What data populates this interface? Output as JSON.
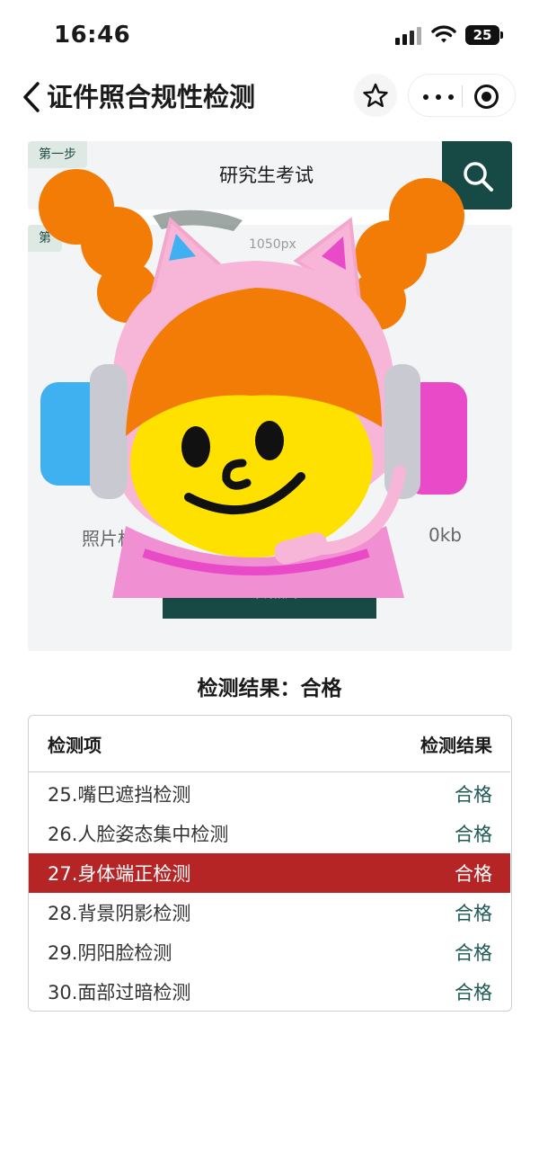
{
  "status_bar": {
    "time": "16:46",
    "battery": "25"
  },
  "nav": {
    "title": "证件照合规性检测"
  },
  "step1": {
    "badge": "第一步",
    "exam": "研究生考试"
  },
  "step2": {
    "badge": "第",
    "size_text": "1050px",
    "format_text": "照片格",
    "kb_text": "0kb",
    "upload_label": "上传照片"
  },
  "result": {
    "heading": "检测结果：合格",
    "col_item": "检测项",
    "col_result": "检测结果",
    "rows": [
      {
        "name": "25.嘴巴遮挡检测",
        "status": "合格"
      },
      {
        "name": "26.人脸姿态集中检测",
        "status": "合格"
      },
      {
        "name": "27.身体端正检测",
        "status": "合格"
      },
      {
        "name": "28.背景阴影检测",
        "status": "合格"
      },
      {
        "name": "29.阴阳脸检测",
        "status": "合格"
      },
      {
        "name": "30.面部过暗检测",
        "status": "合格"
      }
    ]
  },
  "colors": {
    "accent": "#174a44",
    "highlight": "#b52526",
    "pass": "#1d5a55"
  },
  "icons": [
    "back-arrow-icon",
    "star-icon",
    "more-icon",
    "target-icon",
    "search-icon",
    "signal-icon",
    "wifi-icon",
    "battery-icon"
  ]
}
